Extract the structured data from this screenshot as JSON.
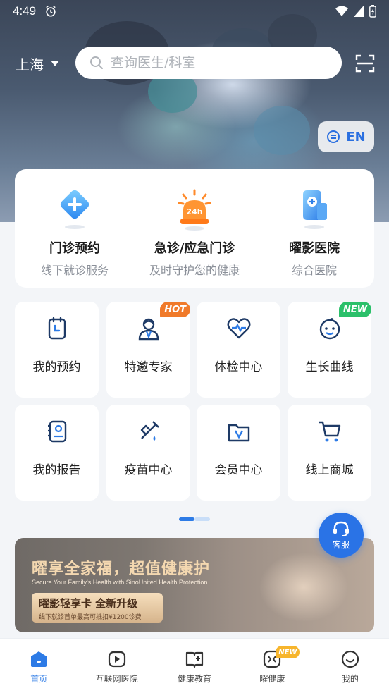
{
  "status_bar": {
    "time": "4:49"
  },
  "header": {
    "city": "上海",
    "search_placeholder": "查询医生/科室",
    "lang_label": "EN"
  },
  "top_services": [
    {
      "title": "门诊预约",
      "subtitle": "线下就诊服务",
      "icon": "clinic-plus-icon"
    },
    {
      "title": "急诊/应急门诊",
      "subtitle": "及时守护您的健康",
      "icon": "emergency-24h-icon"
    },
    {
      "title": "曜影医院",
      "subtitle": "综合医院",
      "icon": "hospital-icon"
    }
  ],
  "grid": [
    {
      "label": "我的预约",
      "icon": "clipboard-clock-icon"
    },
    {
      "label": "特邀专家",
      "icon": "doctor-icon",
      "badge": "HOT"
    },
    {
      "label": "体检中心",
      "icon": "heart-pulse-icon"
    },
    {
      "label": "生长曲线",
      "icon": "baby-face-icon",
      "badge": "NEW"
    },
    {
      "label": "我的报告",
      "icon": "report-icon"
    },
    {
      "label": "疫苗中心",
      "icon": "syringe-icon"
    },
    {
      "label": "会员中心",
      "icon": "vip-folder-icon"
    },
    {
      "label": "线上商城",
      "icon": "shopping-cart-icon"
    }
  ],
  "customer_service": {
    "label": "客服"
  },
  "banner": {
    "title": "曜享全家福，超值健康护",
    "subtitle_en": "Secure Your Family's Health with SinoUnited Health Protection",
    "pill_main": "曜影轻享卡 全新升级",
    "pill_sub": "线下就诊首单最高可抵扣¥1200诊费"
  },
  "bottom_nav": [
    {
      "label": "首页",
      "icon": "home-icon",
      "active": true
    },
    {
      "label": "互联网医院",
      "icon": "video-play-icon"
    },
    {
      "label": "健康教育",
      "icon": "book-plus-icon"
    },
    {
      "label": "曜健康",
      "icon": "health-badge-icon",
      "badge": "NEW"
    },
    {
      "label": "我的",
      "icon": "smile-profile-icon"
    }
  ],
  "colors": {
    "accent": "#2d7be6",
    "hot_badge": "#f07a2a",
    "new_badge": "#2bc06a"
  }
}
